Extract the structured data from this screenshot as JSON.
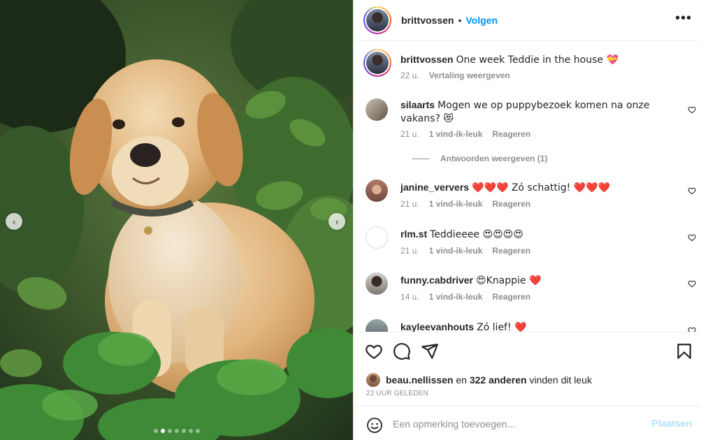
{
  "post": {
    "author": "brittvossen",
    "separator": "•",
    "follow_label": "Volgen",
    "more_label": "•••",
    "image_alt": "Golden retriever puppy sitting among green plants"
  },
  "caption": {
    "user": "brittvossen",
    "text": "One week Teddie in the house 💝",
    "time": "22 u.",
    "translate_label": "Vertaling weergeven"
  },
  "comments": [
    {
      "user": "silaarts",
      "text": "Mogen we op puppybezoek komen na onze vakans? 😻",
      "time": "21 u.",
      "likes": "1 vind-ik-leuk",
      "reply_label": "Reageren",
      "view_replies": "Antwoorden weergeven (1)"
    },
    {
      "user": "janine_ververs",
      "text": "❤️❤️❤️ Zó schattig! ❤️❤️❤️",
      "time": "21 u.",
      "likes": "1 vind-ik-leuk",
      "reply_label": "Reageren"
    },
    {
      "user": "rlm.st",
      "text": "Teddieeee 😍😍😍😍",
      "time": "21 u.",
      "likes": "1 vind-ik-leuk",
      "reply_label": "Reageren"
    },
    {
      "user": "funny.cabdriver",
      "text": "😍Knappie ❤️",
      "time": "14 u.",
      "likes": "1 vind-ik-leuk",
      "reply_label": "Reageren"
    },
    {
      "user": "kayleevanhouts",
      "text": "Zó lief! ❤️"
    }
  ],
  "likes": {
    "liker": "beau.nellissen",
    "and_label": "en",
    "others": "322 anderen",
    "suffix": "vinden dit leuk"
  },
  "time_ago": "22 UUR GELEDEN",
  "comment_box": {
    "placeholder": "Een opmerking toevoegen...",
    "post_label": "Plaatsen"
  },
  "carousel": {
    "prev_icon": "‹",
    "next_icon": "›",
    "current_index": 1,
    "total": 7
  },
  "colors": {
    "accent": "#0095f6",
    "post_disabled": "#b2dffc",
    "muted": "#8e8e8e",
    "text": "#262626",
    "heart_red": "#ed4956"
  }
}
